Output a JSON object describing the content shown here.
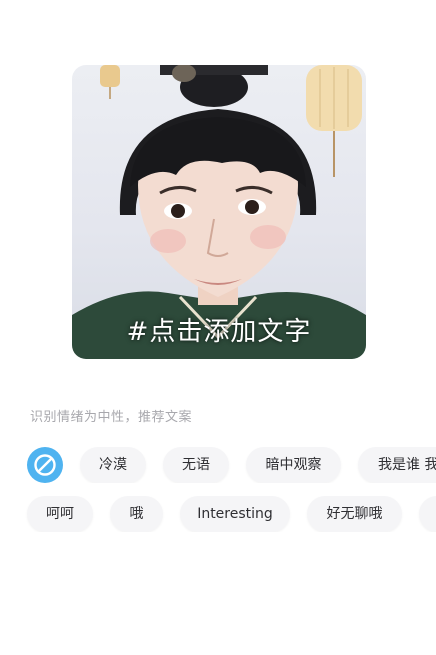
{
  "preview": {
    "overlay_text": "#点击添加文字"
  },
  "hint": "识别情绪为中性，推荐文案",
  "none_button": {
    "icon": "no-text-icon",
    "color": "#4fb3f0"
  },
  "row1": [
    "冷漠",
    "无语",
    "暗中观察",
    "我是谁 我"
  ],
  "row2": [
    "呵呵",
    "哦",
    "Interesting",
    "好无聊哦",
    ""
  ]
}
